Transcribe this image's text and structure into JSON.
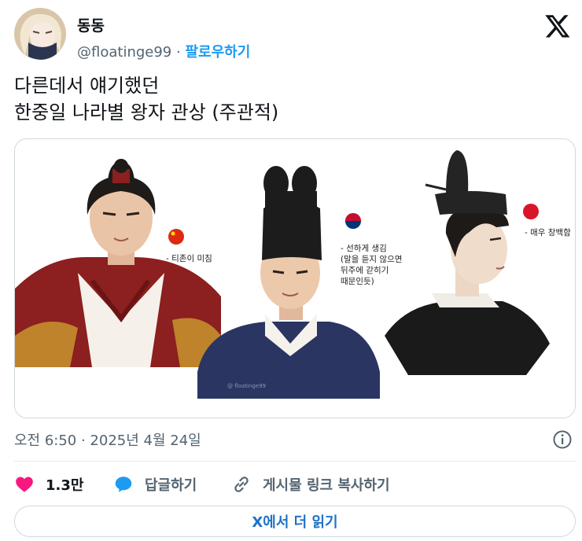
{
  "author": {
    "display_name": "동동",
    "handle": "@floatinge99",
    "separator": "·",
    "follow_label": "팔로우하기"
  },
  "tweet": {
    "lines": [
      "다른데서 얘기했던",
      "한중일 나라별 왕자 관상 (주관적)"
    ]
  },
  "media": {
    "china_caption": "- 티존이 미침",
    "korea_caption_lines": [
      "- 선하게 생김",
      "(말을 듣지 않으면",
      "뒤주에 갇히기",
      "때문인듯)"
    ],
    "japan_caption": "- 매우 창백함",
    "watermark": "@ floatinge99"
  },
  "timestamp": "오전 6:50 · 2025년 4월 24일",
  "actions": {
    "like_count": "1.3만",
    "reply_label": "답글하기",
    "copy_link_label": "게시물 링크 복사하기"
  },
  "read_more_label": "X에서 더 읽기",
  "colors": {
    "accent": "#1d9bf0",
    "like": "#f91880",
    "text_secondary": "#536471"
  }
}
